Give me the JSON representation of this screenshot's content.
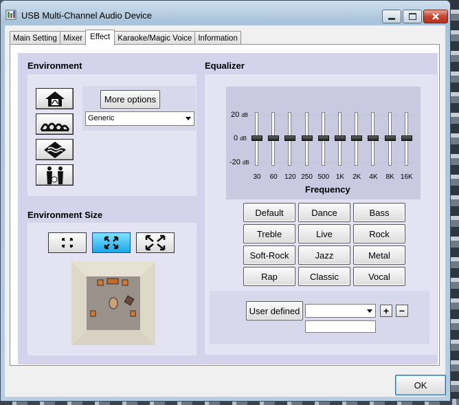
{
  "window": {
    "title": "USB Multi-Channel Audio Device"
  },
  "tabs": [
    {
      "label": "Main Setting"
    },
    {
      "label": "Mixer"
    },
    {
      "label": "Effect"
    },
    {
      "label": "Karaoke/Magic Voice"
    },
    {
      "label": "Information"
    }
  ],
  "active_tab": "Effect",
  "environment": {
    "title": "Environment",
    "more_options_label": "More options",
    "preset_value": "Generic",
    "buttons": [
      "house-icon",
      "opera-house-icon",
      "underwater-icon",
      "musicians-icon"
    ]
  },
  "environment_size": {
    "title": "Environment Size",
    "buttons": [
      "small-room-icon",
      "medium-room-icon",
      "large-room-icon"
    ],
    "selected": "medium-room-icon"
  },
  "equalizer": {
    "title": "Equalizer",
    "db_labels": [
      {
        "num": "20",
        "unit": "dB"
      },
      {
        "num": "0",
        "unit": "dB"
      },
      {
        "num": "-20",
        "unit": "dB"
      }
    ],
    "bands": [
      "30",
      "60",
      "120",
      "250",
      "500",
      "1K",
      "2K",
      "4K",
      "8K",
      "16K"
    ],
    "band_gains_db": [
      0,
      0,
      0,
      0,
      0,
      0,
      0,
      0,
      0,
      0
    ],
    "frequency_label": "Frequency",
    "presets": [
      "Default",
      "Dance",
      "Bass",
      "Treble",
      "Live",
      "Rock",
      "Soft-Rock",
      "Jazz",
      "Metal",
      "Rap",
      "Classic",
      "Vocal"
    ],
    "user_defined_label": "User defined",
    "user_defined_value": "",
    "add_label": "+",
    "remove_label": "−"
  },
  "ok_label": "OK",
  "colors": {
    "panel": "#d3d3ec",
    "box": "#e3e3f3",
    "selected_size": "#1aa6e8"
  }
}
